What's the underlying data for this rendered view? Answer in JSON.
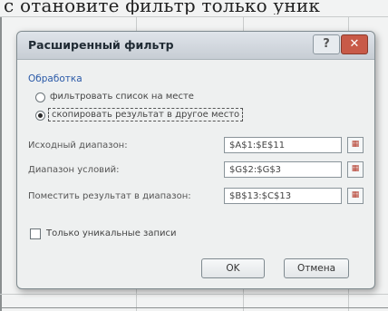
{
  "background": {
    "text": "с отановите фильтр только уник"
  },
  "dialog": {
    "title": "Расширенный фильтр",
    "help_label": "?",
    "close_label": "✕",
    "group_label": "Обработка",
    "radio_options": [
      {
        "label": "фильтровать список на месте",
        "checked": false
      },
      {
        "label": "скопировать результат в другое место",
        "checked": true
      }
    ],
    "fields": [
      {
        "label": "Исходный диапазон:",
        "value": "$A$1:$E$11"
      },
      {
        "label": "Диапазон условий:",
        "value": "$G$2:$G$3"
      },
      {
        "label": "Поместить результат в диапазон:",
        "value": "$B$13:$C$13"
      }
    ],
    "ref_button_icon": "collapse-dialog-icon",
    "unique_checkbox": {
      "label": "Только уникальные записи",
      "checked": false
    },
    "ok_label": "OK",
    "cancel_label": "Отмена"
  },
  "colors": {
    "close_button": "#c85a48",
    "group_label": "#2b5aa8",
    "ref_icon": "#b33a2a"
  }
}
